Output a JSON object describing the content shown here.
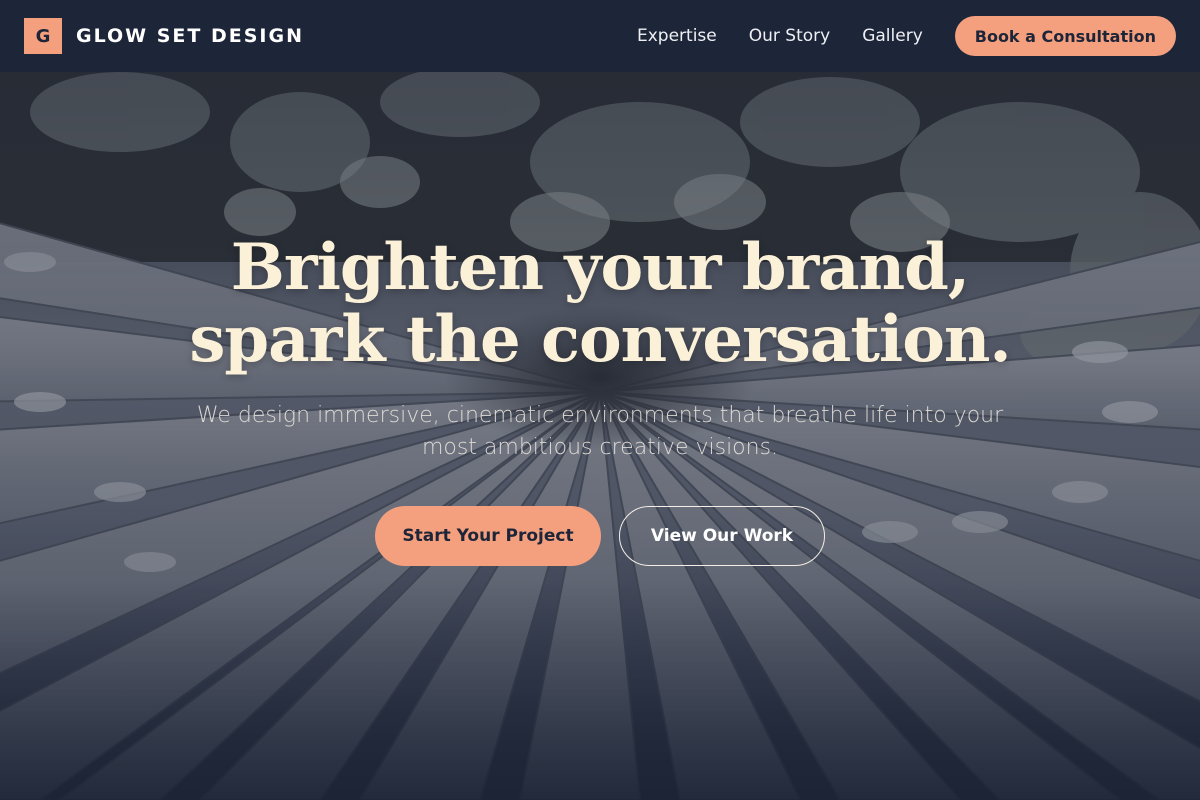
{
  "brand": {
    "logo_letter": "G",
    "name": "GLOW SET DESIGN"
  },
  "nav": {
    "links": [
      "Expertise",
      "Our Story",
      "Gallery"
    ],
    "cta_label": "Book a Consultation"
  },
  "hero": {
    "headline_line1": "Brighten your brand,",
    "headline_line2": "spark the conversation.",
    "subtitle": "We design immersive, cinematic environments that breathe life into your most ambitious creative visions.",
    "primary_button": "Start Your Project",
    "secondary_button": "View Our Work",
    "background_image": "monochrome photo of people lying in a circle with foliage overhead"
  },
  "colors": {
    "navy": "#1d2538",
    "accent": "#f49f7d",
    "headline": "#fbf0d8",
    "nav_text": "#eef0f4"
  }
}
